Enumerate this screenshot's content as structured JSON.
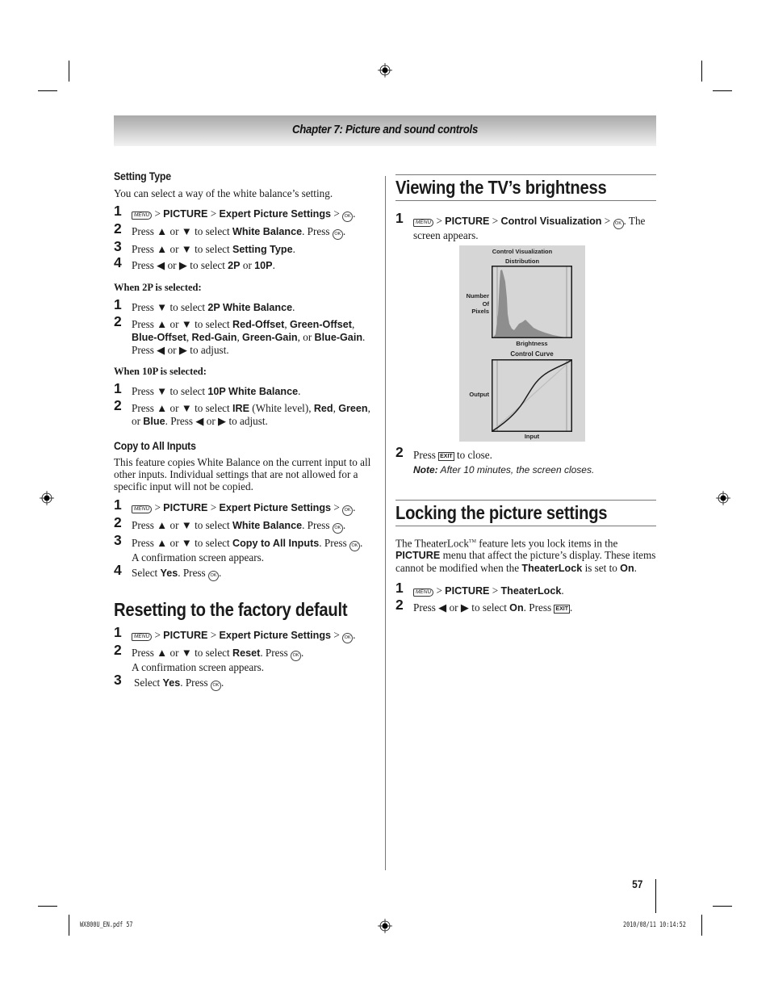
{
  "chapter_title": "Chapter 7: Picture and sound controls",
  "icons": {
    "menu": "MENU",
    "ok": "OK",
    "exit": "EXIT"
  },
  "left": {
    "setting_type": {
      "heading": "Setting Type",
      "intro": "You can select a way of the white balance’s setting.",
      "steps": [
        {
          "num": "1",
          "pre": "> ",
          "b1": "PICTURE",
          "mid": " > ",
          "b2": "Expert Picture Settings",
          "post": " > "
        },
        {
          "num": "2",
          "pre": "Press ▲ or ▼ to select ",
          "b1": "White Balance",
          "post": ". Press "
        },
        {
          "num": "3",
          "pre": "Press ▲ or ▼ to select ",
          "b1": "Setting Type",
          "post": "."
        },
        {
          "num": "4",
          "pre": "Press ◀ or ▶ to select ",
          "b1": "2P",
          "mid": " or ",
          "b2": "10P",
          "post": "."
        }
      ]
    },
    "when_2p": {
      "label": "When 2P is selected:",
      "steps": [
        {
          "num": "1",
          "pre": "Press ▼ to select ",
          "b1": "2P White Balance",
          "post": "."
        },
        {
          "num": "2",
          "pre": "Press ▲ or ▼ to select ",
          "b1": "Red-Offset",
          "s1": ", ",
          "b2": "Green-Offset",
          "s2": ", ",
          "b3": "Blue-Offset",
          "s3": ", ",
          "b4": "Red-Gain",
          "s4": ", ",
          "b5": "Green-Gain",
          "s5": ", or ",
          "b6": "Blue-Gain",
          "post": ". Press ◀ or ▶ to adjust."
        }
      ]
    },
    "when_10p": {
      "label": "When 10P is selected:",
      "steps": [
        {
          "num": "1",
          "pre": "Press ▼ to select ",
          "b1": "10P White Balance",
          "post": "."
        },
        {
          "num": "2",
          "pre": "Press ▲ or ▼ to select ",
          "b1": "IRE",
          "s1": " (White level), ",
          "b2": "Red",
          "s2": ", ",
          "b3": "Green",
          "s3": ", or ",
          "b4": "Blue",
          "post": ". Press ◀ or ▶ to adjust."
        }
      ]
    },
    "copy_all": {
      "heading": "Copy to All Inputs",
      "intro": "This feature copies White Balance on the current input to all other inputs. Individual settings that are not allowed for a specific input will not be copied.",
      "steps": [
        {
          "num": "1",
          "pre": "> ",
          "b1": "PICTURE",
          "mid": " > ",
          "b2": "Expert Picture Settings",
          "post": " > "
        },
        {
          "num": "2",
          "pre": "Press ▲ or ▼ to select ",
          "b1": "White Balance",
          "post": ". Press "
        },
        {
          "num": "3",
          "pre": "Press ▲ or ▼ to select ",
          "b1": "Copy to All Inputs",
          "post": ". Press ",
          "line2": "A confirmation screen appears."
        },
        {
          "num": "4",
          "pre": "Select ",
          "b1": "Yes",
          "post": ". Press "
        }
      ]
    },
    "reset": {
      "heading": "Resetting to the factory default",
      "steps": [
        {
          "num": "1",
          "pre": "> ",
          "b1": "PICTURE",
          "mid": " > ",
          "b2": "Expert Picture Settings",
          "post": " > "
        },
        {
          "num": "2",
          "pre": "Press ▲ or ▼ to select ",
          "b1": "Reset",
          "post": ". Press ",
          "line2": "A confirmation screen appears."
        },
        {
          "num": "3",
          "pre": "Select ",
          "b1": "Yes",
          "post": ". Press "
        }
      ]
    }
  },
  "right": {
    "brightness": {
      "heading": "Viewing the TV’s brightness",
      "step1": {
        "num": "1",
        "pre": "> ",
        "b1": "PICTURE",
        "mid": " > ",
        "b2": "Control Visualization",
        "post": " > ",
        "tail": ". The screen appears."
      },
      "step2": {
        "num": "2",
        "pre": "Press ",
        "post": " to close."
      },
      "note_label": "Note:",
      "note_text": " After 10 minutes, the screen closes."
    },
    "figure": {
      "title_line1": "Control Visualization",
      "title_line2": "Distribution",
      "y_label_1": "Number",
      "y_label_2": "Of",
      "y_label_3": "Pixels",
      "x_label_top": "Brightness",
      "curve_title": "Control Curve",
      "curve_y_label": "Output",
      "curve_x_label": "Input"
    },
    "locking": {
      "heading": "Locking the picture settings",
      "intro_a": "The TheaterLock",
      "tm": "TM",
      "intro_b": " feature lets you lock items in the ",
      "intro_b1": "PICTURE",
      "intro_c": " menu that affect the picture’s display.  These items cannot be modified when the ",
      "intro_b2": "TheaterLock",
      "intro_d": " is set to ",
      "intro_b3": "On",
      "intro_e": ".",
      "step1": {
        "num": "1",
        "pre": "> ",
        "b1": "PICTURE",
        "mid": " > ",
        "b2": "TheaterLock",
        "post": "."
      },
      "step2": {
        "num": "2",
        "pre": "Press ◀ or ▶ to select ",
        "b1": "On",
        "post": ". Press "
      }
    }
  },
  "footer": {
    "page_number": "57",
    "file_slug": "WX800U_EN.pdf   57",
    "date_slug": "2010/08/11    10:14:52"
  }
}
